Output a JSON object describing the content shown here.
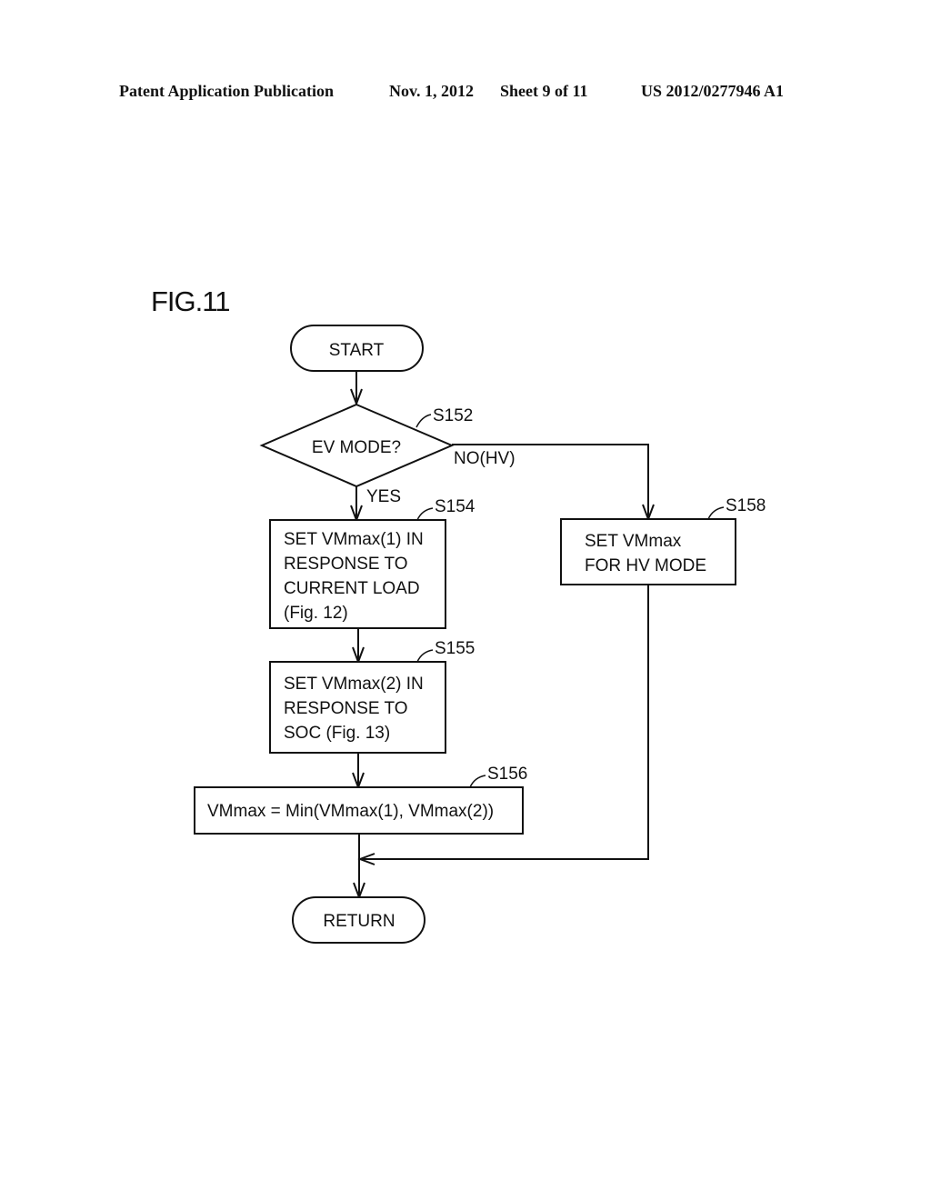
{
  "header": {
    "publication_type": "Patent Application Publication",
    "date": "Nov. 1, 2012",
    "sheet": "Sheet 9 of 11",
    "publication_number": "US 2012/0277946 A1"
  },
  "figure": {
    "title": "FIG.11",
    "nodes": {
      "start": {
        "label": "START"
      },
      "s152": {
        "ref": "S152",
        "label": "EV MODE?",
        "yes_label": "YES",
        "no_label": "NO(HV)"
      },
      "s154": {
        "ref": "S154",
        "lines": [
          "SET VMmax(1) IN",
          "RESPONSE TO",
          "CURRENT LOAD",
          "(Fig. 12)"
        ]
      },
      "s155": {
        "ref": "S155",
        "lines": [
          "SET VMmax(2) IN",
          "RESPONSE TO",
          "SOC (Fig. 13)"
        ]
      },
      "s156": {
        "ref": "S156",
        "label": "VMmax = Min(VMmax(1), VMmax(2))"
      },
      "s158": {
        "ref": "S158",
        "lines": [
          "SET VMmax",
          "FOR HV MODE"
        ]
      },
      "return": {
        "label": "RETURN"
      }
    }
  }
}
